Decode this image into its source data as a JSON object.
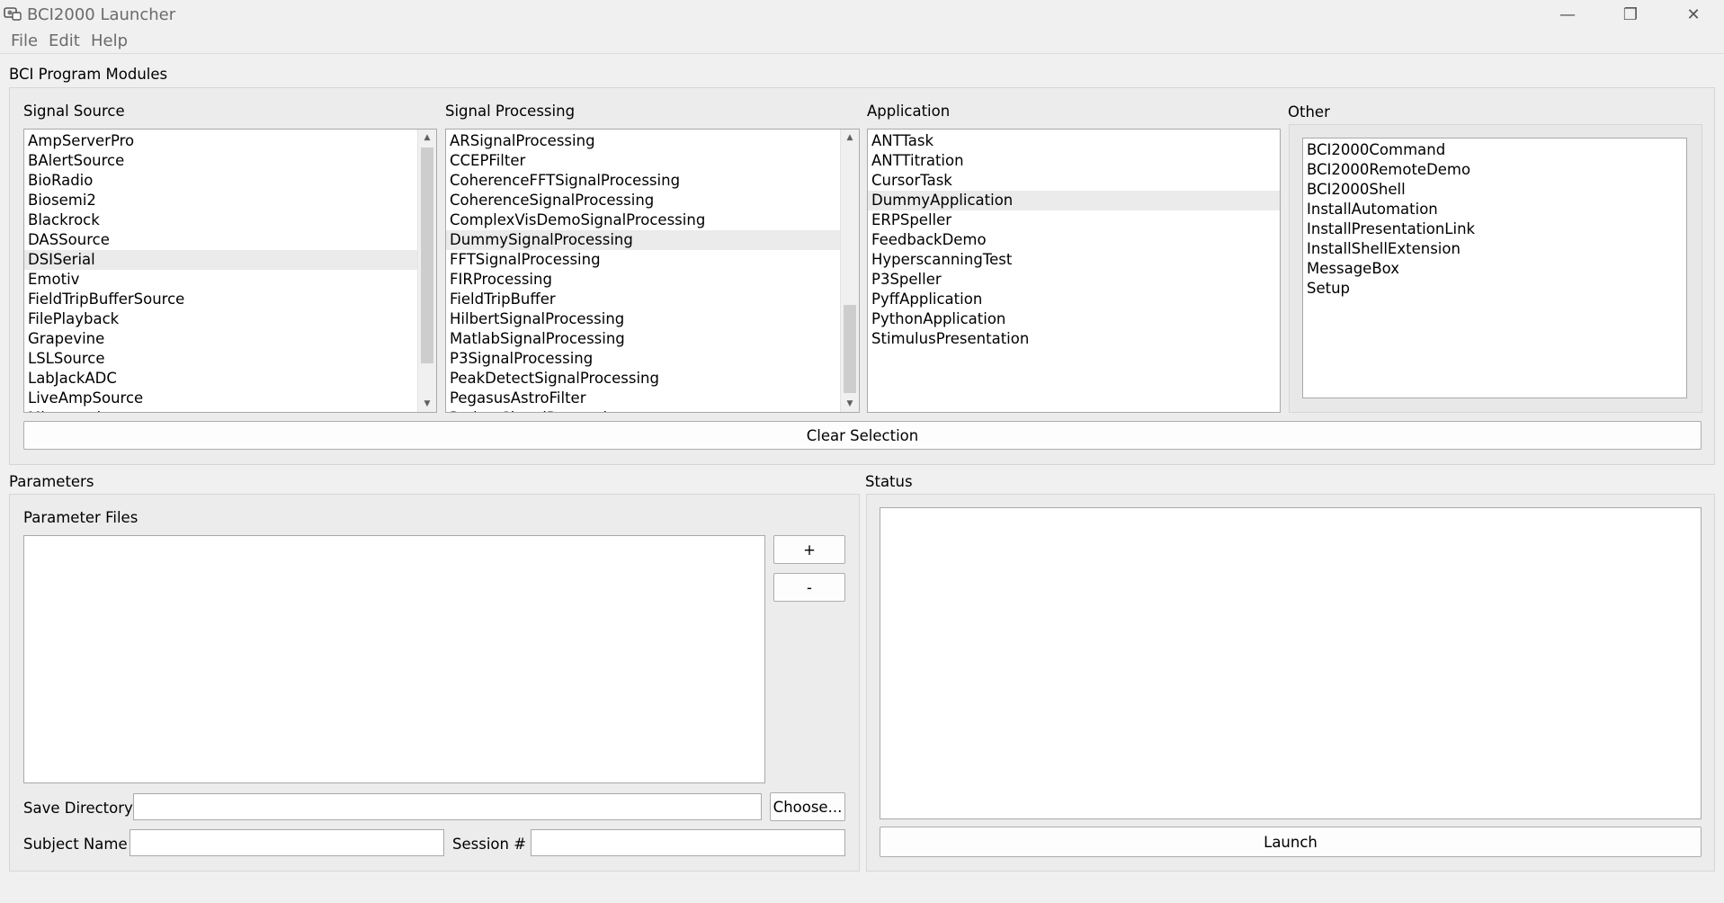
{
  "window": {
    "title": "BCI2000 Launcher",
    "minimize": "—",
    "restore": "❐",
    "close": "✕"
  },
  "menu": [
    "File",
    "Edit",
    "Help"
  ],
  "modules": {
    "group_title": "BCI Program Modules",
    "signal_source": {
      "title": "Signal Source",
      "items": [
        "AmpServerPro",
        "BAlertSource",
        "BioRadio",
        "Biosemi2",
        "Blackrock",
        "DASSource",
        "DSISerial",
        "Emotiv",
        "FieldTripBufferSource",
        "FilePlayback",
        "Grapevine",
        "LSLSource",
        "LabJackADC",
        "LiveAmpSource",
        "Micromed"
      ],
      "selected": "DSISerial"
    },
    "signal_processing": {
      "title": "Signal Processing",
      "items": [
        "ARSignalProcessing",
        "CCEPFilter",
        "CoherenceFFTSignalProcessing",
        "CoherenceSignalProcessing",
        "ComplexVisDemoSignalProcessing",
        "DummySignalProcessing",
        "FFTSignalProcessing",
        "FIRProcessing",
        "FieldTripBuffer",
        "HilbertSignalProcessing",
        "MatlabSignalProcessing",
        "P3SignalProcessing",
        "PeakDetectSignalProcessing",
        "PegasusAstroFilter",
        "PythonSignalProcessing"
      ],
      "selected": "DummySignalProcessing"
    },
    "application": {
      "title": "Application",
      "items": [
        "ANTTask",
        "ANTTitration",
        "CursorTask",
        "DummyApplication",
        "ERPSpeller",
        "FeedbackDemo",
        "HyperscanningTest",
        "P3Speller",
        "PyffApplication",
        "PythonApplication",
        "StimulusPresentation"
      ],
      "selected": "DummyApplication"
    },
    "other": {
      "title": "Other",
      "items": [
        "BCI2000Command",
        "BCI2000RemoteDemo",
        "BCI2000Shell",
        "InstallAutomation",
        "InstallPresentationLink",
        "InstallShellExtension",
        "MessageBox",
        "Setup"
      ]
    },
    "clear_button": "Clear Selection"
  },
  "parameters": {
    "group_title": "Parameters",
    "files_label": "Parameter Files",
    "add_button": "+",
    "remove_button": "-",
    "save_dir_label": "Save Directory",
    "save_dir_value": "",
    "choose_button": "Choose...",
    "subject_label": "Subject Name",
    "subject_value": "",
    "session_label": "Session #",
    "session_value": ""
  },
  "status": {
    "group_title": "Status",
    "text": "",
    "launch_button": "Launch"
  },
  "icons": {
    "app": "bci2000-app-icon",
    "scroll_up": "scroll-up-arrow-icon",
    "scroll_down": "scroll-down-arrow-icon"
  }
}
